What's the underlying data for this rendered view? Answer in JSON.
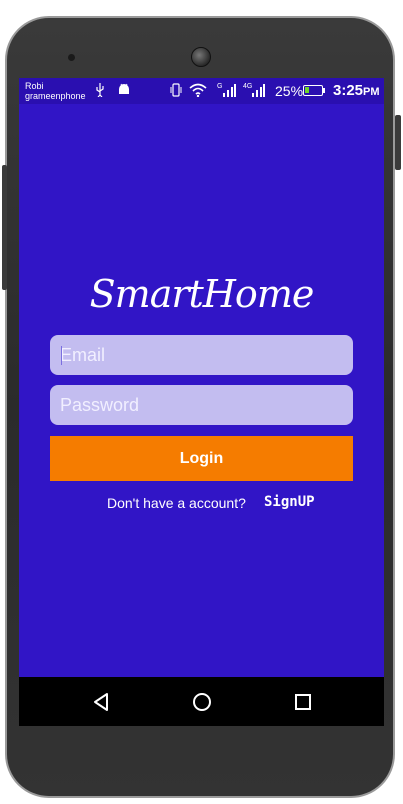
{
  "status_bar": {
    "carrier_line1": "Robi",
    "carrier_line2": "grameenphone",
    "battery_percent": "25%",
    "battery_level": 0.25,
    "time": "3:25",
    "time_suffix": "PM",
    "icons": [
      "usb-icon",
      "android-debug-icon",
      "vibrate-icon",
      "wifi-icon",
      "signal-g-icon",
      "signal-4g-icon",
      "battery-charging-icon"
    ],
    "signal_labels": {
      "sim1": "G",
      "sim2": "4G"
    }
  },
  "app": {
    "title": "SmartHome",
    "email_placeholder": "Email",
    "password_placeholder": "Password",
    "login_label": "Login",
    "signup_prompt": "Don't have a account?",
    "signup_label": "SignUP"
  },
  "nav": {
    "back": "back-icon",
    "home": "home-icon",
    "recents": "recents-icon"
  },
  "colors": {
    "background": "#3115c6",
    "status_bar": "#2a0fb0",
    "input": "#c3bdf0",
    "button": "#f57c00"
  }
}
